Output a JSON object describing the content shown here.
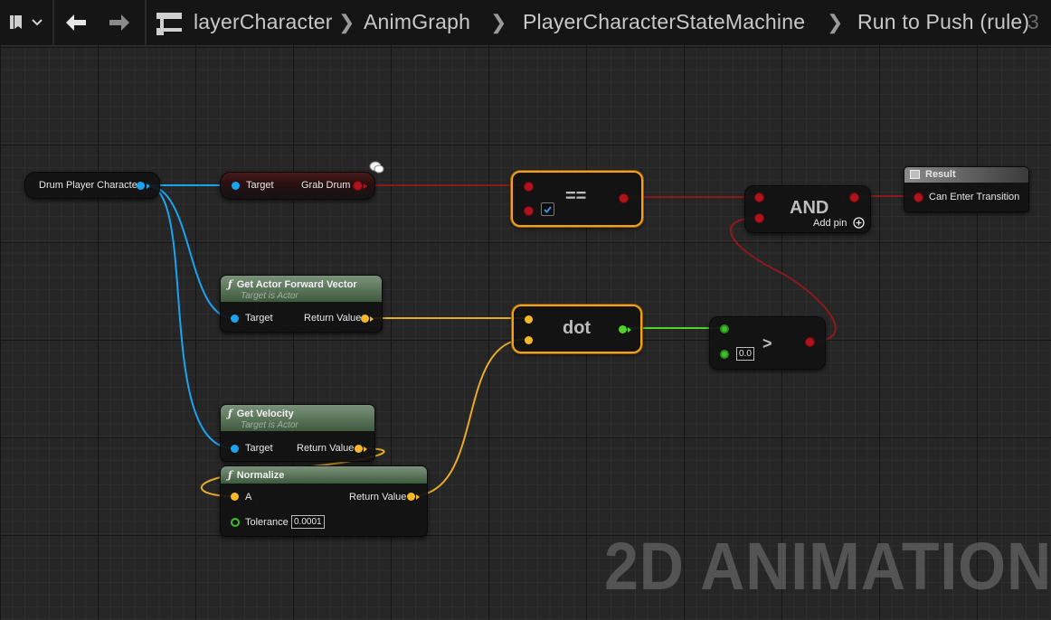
{
  "toolbar": {
    "icons": [
      "bookmark-icon",
      "chevron-down-icon",
      "back-arrow-icon",
      "forward-arrow-icon",
      "hierarchy-icon"
    ],
    "breadcrumbs": [
      "layerCharacter",
      "AnimGraph",
      "PlayerCharacterStateMachine",
      "Run to Push (rule)"
    ],
    "right_overlay": "3"
  },
  "nodes": {
    "drum_player_character": {
      "label": "Drum Player Character"
    },
    "grab_drum": {
      "target_label": "Target",
      "output_label": "Grab Drum"
    },
    "equals": {
      "op": "==",
      "checkbox_checked": true
    },
    "and": {
      "op": "AND",
      "add_pin_label": "Add pin"
    },
    "result": {
      "title": "Result",
      "pin_label": "Can Enter Transition"
    },
    "get_actor_forward_vector": {
      "title": "Get Actor Forward Vector",
      "subtitle": "Target is Actor",
      "target_label": "Target",
      "return_label": "Return Value"
    },
    "dot": {
      "op": "dot"
    },
    "greater": {
      "op": ">",
      "default_value": "0.0"
    },
    "get_velocity": {
      "title": "Get Velocity",
      "subtitle": "Target is Actor",
      "target_label": "Target",
      "return_label": "Return Value"
    },
    "normalize": {
      "title": "Normalize",
      "a_label": "A",
      "return_label": "Return Value",
      "tolerance_label": "Tolerance",
      "tolerance_value": "0.0001"
    }
  },
  "colors": {
    "object_pin": "#1aa4f0",
    "vector_pin": "#f5b82a",
    "bool_pin": "#b0131d",
    "float_pin": "#4fd22a",
    "selection": "#f4a11a",
    "pure_header": "#5e7a5d"
  },
  "watermark": "2D ANIMATION"
}
